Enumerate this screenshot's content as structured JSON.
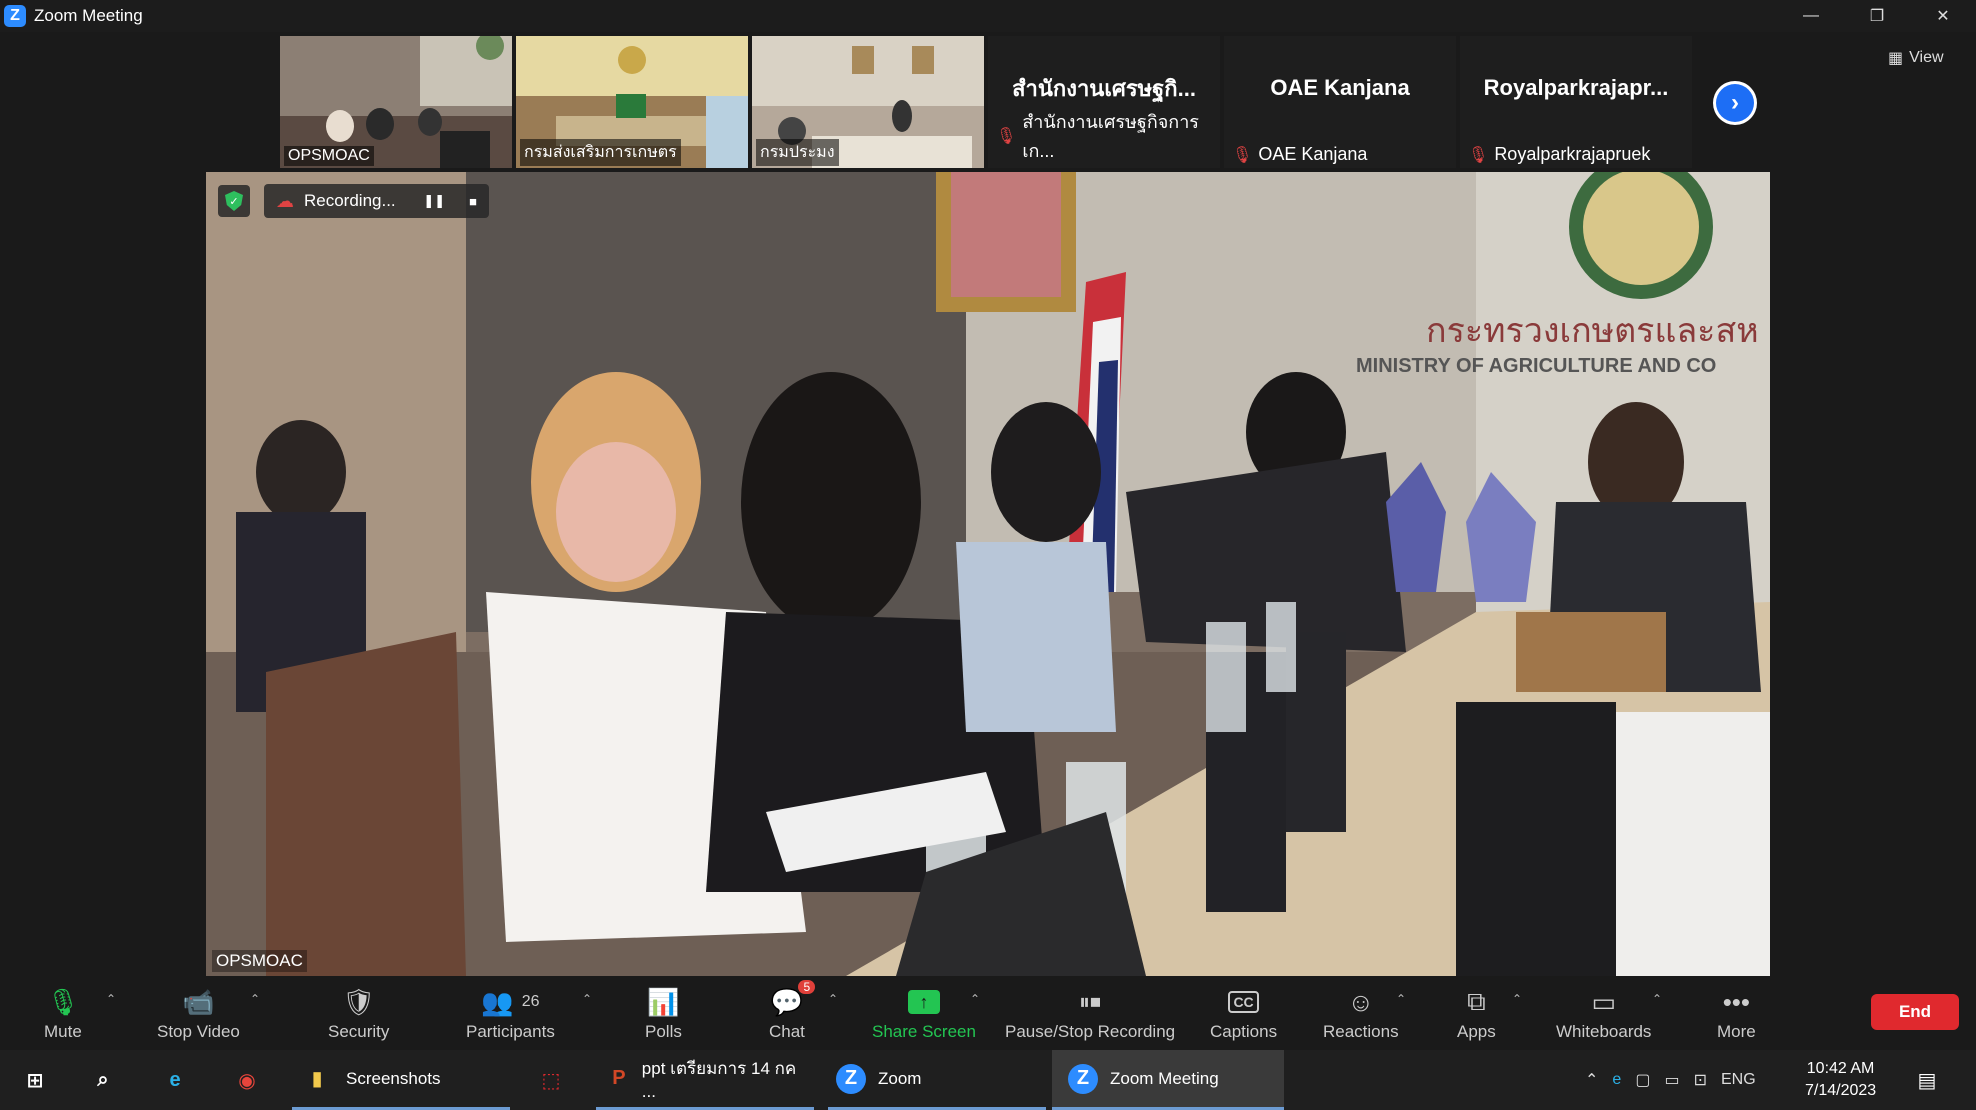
{
  "window": {
    "title": "Zoom Meeting",
    "minimize": "—",
    "restore": "❐",
    "close": "✕"
  },
  "strip": {
    "thumbs": [
      {
        "name": "OPSMOAC",
        "active": true
      },
      {
        "name": "กรมส่งเสริมการเกษตร"
      },
      {
        "name": "กรมประมง"
      }
    ],
    "text_tiles": [
      {
        "display": "สำนักงานเศรษฐกิ...",
        "name": "สำนักงานเศรษฐกิจการเก..."
      },
      {
        "display": "OAE Kanjana",
        "name": "OAE Kanjana"
      },
      {
        "display": "Royalparkrajapr...",
        "name": "Royalparkrajapruek"
      }
    ],
    "view_label": "View"
  },
  "main": {
    "recording_label": "Recording...",
    "speaker_name": "OPSMOAC",
    "wall_text_thai": "กระทรวงเกษตรและสห",
    "wall_text_en": "MINISTRY OF AGRICULTURE AND CO"
  },
  "toolbar": {
    "mute": "Mute",
    "stop_video": "Stop Video",
    "security": "Security",
    "participants": "Participants",
    "participants_count": "26",
    "polls": "Polls",
    "chat": "Chat",
    "chat_badge": "5",
    "share": "Share Screen",
    "record": "Pause/Stop Recording",
    "captions": "Captions",
    "captions_icon": "CC",
    "reactions": "Reactions",
    "apps": "Apps",
    "whiteboards": "Whiteboards",
    "more": "More",
    "end": "End"
  },
  "taskbar": {
    "items": [
      {
        "label": "Screenshots"
      },
      {
        "label": "ppt เตรียมการ 14 กค ..."
      },
      {
        "label": "Zoom"
      },
      {
        "label": "Zoom Meeting"
      }
    ],
    "lang": "ENG",
    "time": "10:42 AM",
    "date": "7/14/2023"
  },
  "colors": {
    "accent": "#2d8cff",
    "share_green": "#23c552",
    "end_red": "#e0292e",
    "mic_off": "#e04343"
  }
}
